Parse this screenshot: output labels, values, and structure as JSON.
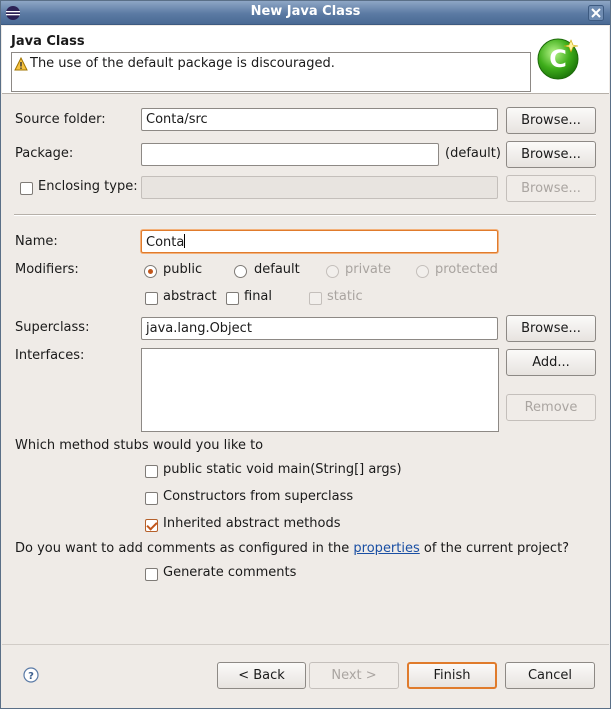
{
  "window": {
    "title": "New Java Class"
  },
  "banner": {
    "title": "Java Class",
    "message": "The use of the default package is discouraged."
  },
  "form": {
    "source_folder": {
      "label": "Source folder:",
      "value": "Conta/src",
      "button": "Browse..."
    },
    "package": {
      "label": "Package:",
      "value": "",
      "suffix": "(default)",
      "button": "Browse..."
    },
    "enclosing_type": {
      "label": "Enclosing type:",
      "checked": false,
      "value": "",
      "button": "Browse..."
    },
    "name": {
      "label": "Name:",
      "value": "Conta"
    },
    "modifiers": {
      "label": "Modifiers:",
      "access": [
        {
          "label": "public",
          "selected": true,
          "enabled": true
        },
        {
          "label": "default",
          "selected": false,
          "enabled": true
        },
        {
          "label": "private",
          "selected": false,
          "enabled": false
        },
        {
          "label": "protected",
          "selected": false,
          "enabled": false
        }
      ],
      "flags": [
        {
          "label": "abstract",
          "checked": false,
          "enabled": true
        },
        {
          "label": "final",
          "checked": false,
          "enabled": true
        },
        {
          "label": "static",
          "checked": false,
          "enabled": false
        }
      ]
    },
    "superclass": {
      "label": "Superclass:",
      "value": "java.lang.Object",
      "button": "Browse..."
    },
    "interfaces": {
      "label": "Interfaces:",
      "add_button": "Add...",
      "remove_button": "Remove"
    },
    "stubs": {
      "question": "Which method stubs would you like to",
      "options": [
        {
          "label": "public static void main(String[] args)",
          "checked": false
        },
        {
          "label": "Constructors from superclass",
          "checked": false
        },
        {
          "label": "Inherited abstract methods",
          "checked": true
        }
      ]
    },
    "comments": {
      "question_before": "Do you want to add comments as configured in the ",
      "link": "properties",
      "question_after": " of the current project?",
      "option": {
        "label": "Generate comments",
        "checked": false
      }
    }
  },
  "footer": {
    "back": "< Back",
    "next": "Next >",
    "finish": "Finish",
    "cancel": "Cancel"
  },
  "colors": {
    "accent": "#e07b2c",
    "link": "#1a4fa3",
    "titlebar": "#5b7aa3"
  },
  "icons": [
    "eclipse-app-icon",
    "close-icon",
    "warning-icon",
    "new-class-icon",
    "help-icon"
  ]
}
